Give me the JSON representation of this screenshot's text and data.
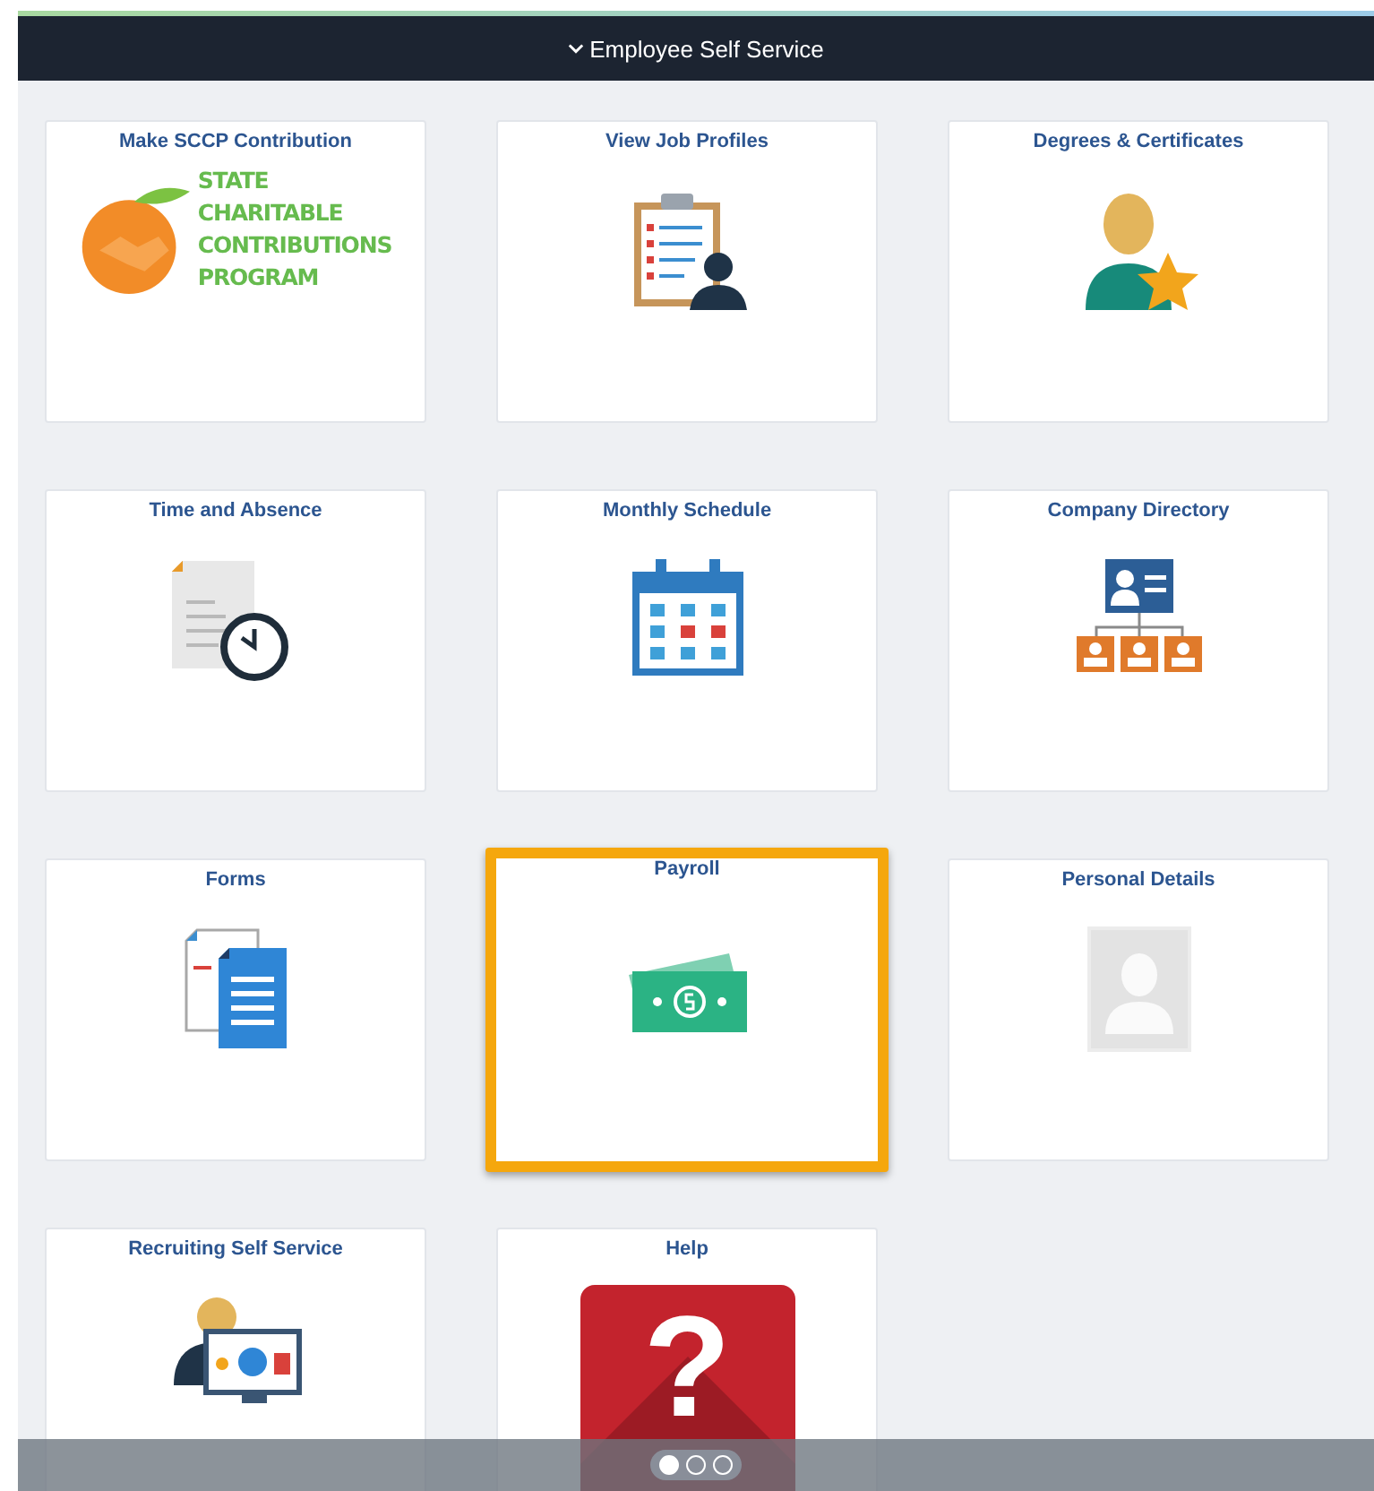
{
  "header": {
    "title": "Employee Self Service",
    "expanded": true
  },
  "tiles": [
    {
      "title": "Make SCCP Contribution",
      "kind": "sccp",
      "highlighted": false,
      "logo_lines": [
        "STATE",
        "CHARITABLE",
        "CONTRIBUTIONS",
        "PROGRAM"
      ]
    },
    {
      "title": "View Job Profiles",
      "kind": "clipboard",
      "highlighted": false
    },
    {
      "title": "Degrees & Certificates",
      "kind": "person-star",
      "highlighted": false
    },
    {
      "title": "Time and Absence",
      "kind": "doc-clock",
      "highlighted": false
    },
    {
      "title": "Monthly Schedule",
      "kind": "calendar",
      "highlighted": false
    },
    {
      "title": "Company Directory",
      "kind": "org-chart",
      "highlighted": false
    },
    {
      "title": "Forms",
      "kind": "documents",
      "highlighted": false
    },
    {
      "title": "Payroll",
      "kind": "money",
      "highlighted": true
    },
    {
      "title": "Personal Details",
      "kind": "photo-placeholder",
      "highlighted": false
    },
    {
      "title": "Recruiting Self Service",
      "kind": "recruiter",
      "highlighted": false
    },
    {
      "title": "Help",
      "kind": "help",
      "highlighted": false,
      "glyph": "?"
    }
  ],
  "pages": [
    {
      "selected": true
    },
    {
      "selected": false
    },
    {
      "selected": false
    }
  ]
}
